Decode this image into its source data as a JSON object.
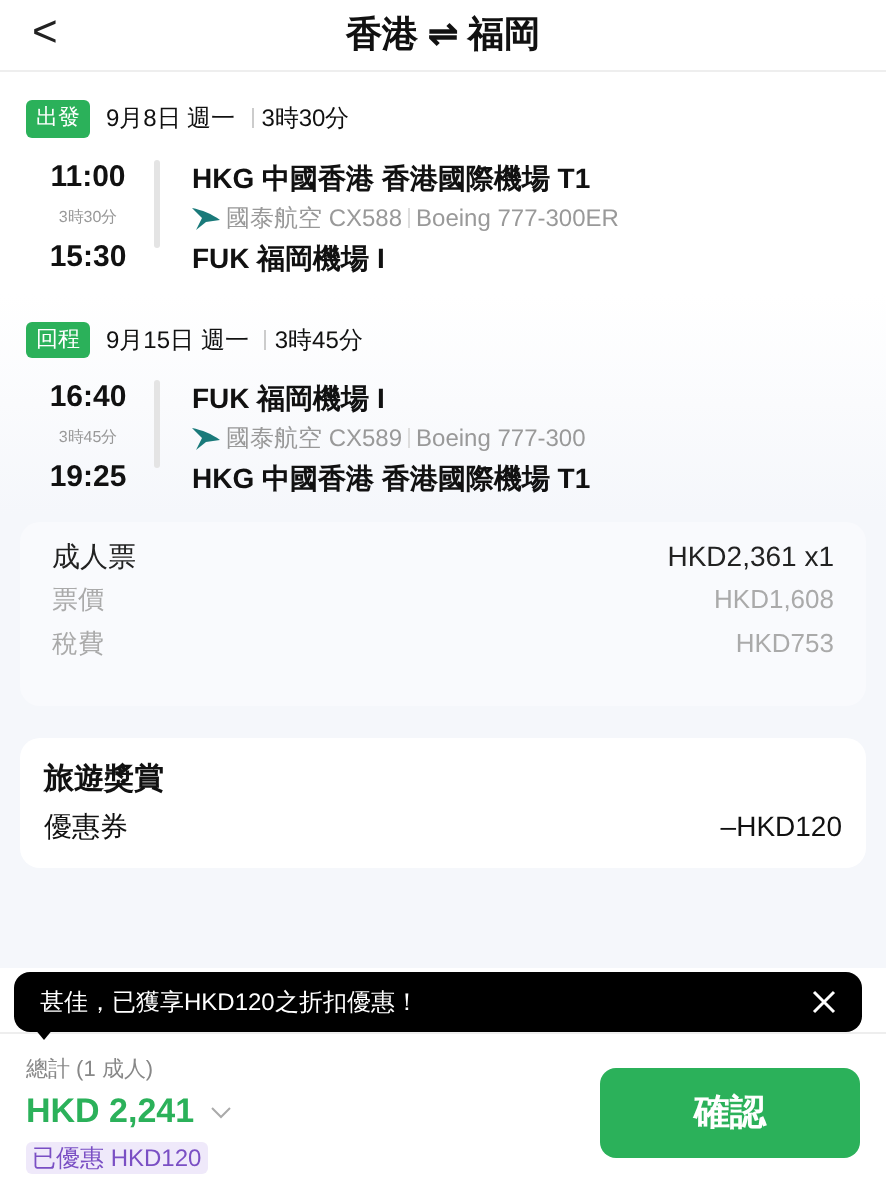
{
  "header": {
    "back": "<",
    "title": "香港 ⇌ 福岡"
  },
  "segments": [
    {
      "tag": "出發",
      "date": "9月8日 週一",
      "duration": "3時30分",
      "depart_time": "11:00",
      "leg_duration": "3時30分",
      "arrive_time": "15:30",
      "from": "HKG 中國香港 香港國際機場 T1",
      "airline": "國泰航空 CX588",
      "aircraft": "Boeing 777-300ER",
      "to": "FUK 福岡機場 I"
    },
    {
      "tag": "回程",
      "date": "9月15日 週一",
      "duration": "3時45分",
      "depart_time": "16:40",
      "leg_duration": "3時45分",
      "arrive_time": "19:25",
      "from": "FUK 福岡機場 I",
      "airline": "國泰航空 CX589",
      "aircraft": "Boeing 777-300",
      "to": "HKG 中國香港 香港國際機場 T1"
    }
  ],
  "price": {
    "rows": [
      {
        "kind": "main",
        "label": "成人票",
        "value": "HKD2,361 x1"
      },
      {
        "kind": "sub",
        "label": "票價",
        "value": "HKD1,608"
      },
      {
        "kind": "sub",
        "label": "稅費",
        "value": "HKD753"
      }
    ]
  },
  "rewards": {
    "title": "旅遊獎賞",
    "label": "優惠券",
    "value": "–HKD120"
  },
  "toast": {
    "text": "甚佳，已獲享HKD120之折扣優惠！"
  },
  "footer": {
    "total_label": "總計 (1 成人)",
    "total": "HKD 2,241",
    "discount": "已優惠 HKD120",
    "confirm": "確認"
  }
}
